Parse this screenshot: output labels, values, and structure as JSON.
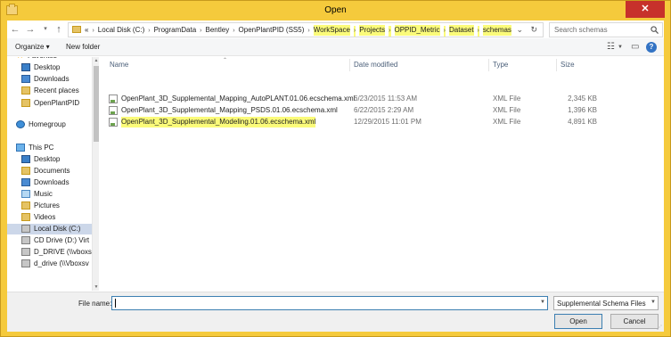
{
  "window": {
    "title": "Open",
    "close_glyph": "✕"
  },
  "address": {
    "crumbs": [
      {
        "label": "«",
        "highlighted": false
      },
      {
        "label": "Local Disk (C:)",
        "highlighted": false
      },
      {
        "label": "ProgramData",
        "highlighted": false
      },
      {
        "label": "Bentley",
        "highlighted": false
      },
      {
        "label": "OpenPlantPID (SS5)",
        "highlighted": false
      },
      {
        "label": "WorkSpace",
        "highlighted": true
      },
      {
        "label": "Projects",
        "highlighted": true
      },
      {
        "label": "OPPID_Metric",
        "highlighted": true
      },
      {
        "label": "Dataset",
        "highlighted": true
      },
      {
        "label": "schemas",
        "highlighted": true
      }
    ],
    "highlight_color": "#fbfb7a"
  },
  "search": {
    "placeholder": "Search schemas"
  },
  "toolbar": {
    "organize": "Organize ▾",
    "new_folder": "New folder"
  },
  "navpane": {
    "items": [
      {
        "label": "Favorites",
        "icon": "star-icon"
      },
      {
        "label": "Desktop",
        "icon": "desktop-icon"
      },
      {
        "label": "Downloads",
        "icon": "downloads-icon"
      },
      {
        "label": "Recent places",
        "icon": "recent-places-icon"
      },
      {
        "label": "OpenPlantPID",
        "icon": "folder-icon"
      },
      {
        "label": "Homegroup",
        "icon": "homegroup-icon"
      },
      {
        "label": "This PC",
        "icon": "computer-icon"
      },
      {
        "label": "Desktop",
        "icon": "desktop-icon"
      },
      {
        "label": "Documents",
        "icon": "documents-icon"
      },
      {
        "label": "Downloads",
        "icon": "downloads-icon"
      },
      {
        "label": "Music",
        "icon": "music-icon"
      },
      {
        "label": "Pictures",
        "icon": "pictures-icon"
      },
      {
        "label": "Videos",
        "icon": "videos-icon"
      },
      {
        "label": "Local Disk (C:)",
        "icon": "drive-icon",
        "selected": true
      },
      {
        "label": "CD Drive (D:) Virt",
        "icon": "cd-drive-icon"
      },
      {
        "label": "D_DRIVE (\\\\vboxs",
        "icon": "network-drive-icon"
      },
      {
        "label": "d_drive (\\\\Vboxsv",
        "icon": "network-drive-icon"
      }
    ]
  },
  "filelist": {
    "columns": {
      "name": "Name",
      "date": "Date modified",
      "type": "Type",
      "size": "Size"
    },
    "rows": [
      {
        "name": "OpenPlant_3D_Supplemental_Mapping_AutoPLANT.01.06.ecschema.xml",
        "date": "6/23/2015 11:53 AM",
        "type": "XML File",
        "size": "2,345 KB",
        "highlighted": false
      },
      {
        "name": "OpenPlant_3D_Supplemental_Mapping_PSDS.01.06.ecschema.xml",
        "date": "6/22/2015 2:29 AM",
        "type": "XML File",
        "size": "1,396 KB",
        "highlighted": false
      },
      {
        "name": "OpenPlant_3D_Supplemental_Modeling.01.06.ecschema.xml",
        "date": "12/29/2015 11:01 PM",
        "type": "XML File",
        "size": "4,891 KB",
        "highlighted": true
      }
    ]
  },
  "bottom": {
    "file_name_label": "File name:",
    "file_name_value": "",
    "filter": "Supplemental Schema Files (Op",
    "open": "Open",
    "cancel": "Cancel"
  }
}
